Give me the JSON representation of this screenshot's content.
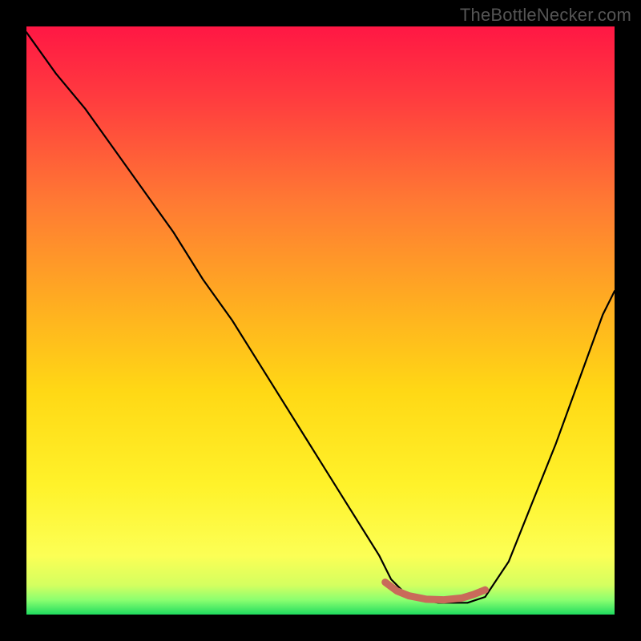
{
  "watermark": "TheBottleNecker.com",
  "chart_data": {
    "type": "line",
    "title": "",
    "xlabel": "",
    "ylabel": "",
    "xlim": [
      0,
      100
    ],
    "ylim": [
      0,
      100
    ],
    "series": [
      {
        "name": "bottleneck-curve",
        "x": [
          0,
          5,
          10,
          15,
          20,
          25,
          30,
          35,
          40,
          45,
          50,
          55,
          60,
          62,
          65,
          70,
          75,
          78,
          82,
          86,
          90,
          94,
          98,
          100
        ],
        "values": [
          99,
          92,
          86,
          79,
          72,
          65,
          57,
          50,
          42,
          34,
          26,
          18,
          10,
          6,
          3,
          2,
          2,
          3,
          9,
          19,
          29,
          40,
          51,
          55
        ]
      },
      {
        "name": "highlight-segment",
        "x": [
          61,
          63,
          65,
          68,
          71,
          74,
          76,
          78
        ],
        "values": [
          5.5,
          4.0,
          3.2,
          2.6,
          2.5,
          2.8,
          3.4,
          4.2
        ]
      }
    ],
    "gradient_stops": [
      {
        "offset": 0.0,
        "color": "#ff1744"
      },
      {
        "offset": 0.12,
        "color": "#ff3b3f"
      },
      {
        "offset": 0.3,
        "color": "#ff7a33"
      },
      {
        "offset": 0.48,
        "color": "#ffb020"
      },
      {
        "offset": 0.62,
        "color": "#ffd815"
      },
      {
        "offset": 0.78,
        "color": "#fff22a"
      },
      {
        "offset": 0.9,
        "color": "#fcff55"
      },
      {
        "offset": 0.95,
        "color": "#d4ff60"
      },
      {
        "offset": 0.975,
        "color": "#8cff70"
      },
      {
        "offset": 1.0,
        "color": "#1fdb5f"
      }
    ],
    "highlight_color": "#c96a5a",
    "curve_color": "#000000"
  }
}
